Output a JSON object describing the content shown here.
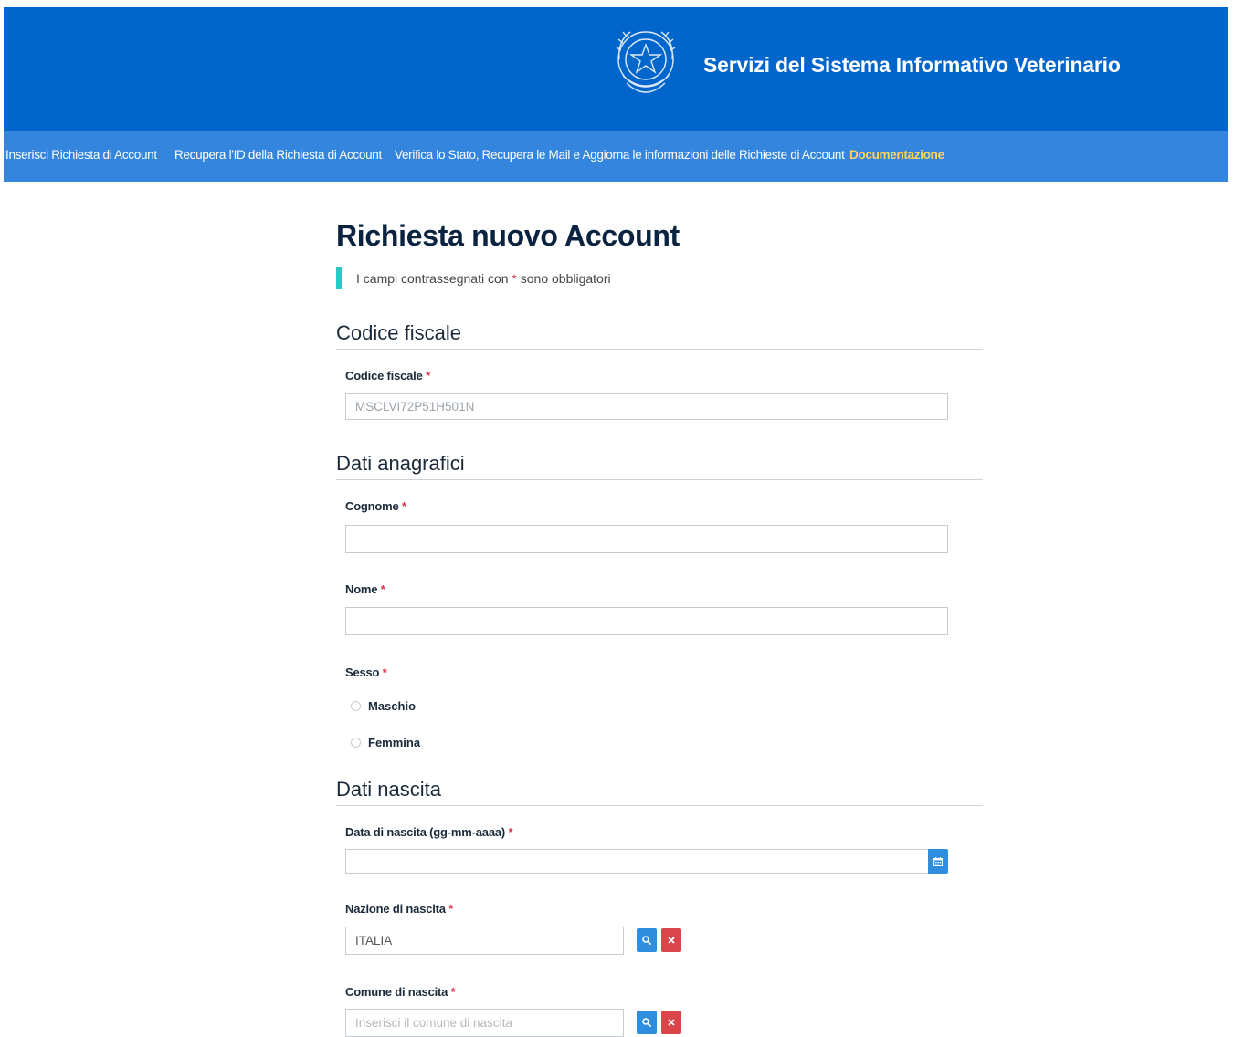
{
  "header": {
    "site_title": "Servizi del Sistema Informativo Veterinario",
    "emblem_icon": "italian-republic-emblem-icon",
    "background_color": "#0066cc"
  },
  "nav": {
    "background_color": "#3385dd",
    "items": [
      {
        "label": "Inserisci Richiesta di Account",
        "active": false
      },
      {
        "label": "Recupera l'ID della Richiesta di Account",
        "active": false
      },
      {
        "label": "Verifica lo Stato, Recupera le Mail e Aggiorna le informazioni delle Richieste di Account",
        "active": false
      },
      {
        "label": "Documentazione",
        "active": true
      }
    ],
    "active_color": "#ffd35a"
  },
  "form": {
    "title": "Richiesta nuovo Account",
    "required_note_prefix": "I campi contrassegnati con ",
    "required_star": "*",
    "required_note_suffix": " sono obbligatori",
    "sections": {
      "codice_fiscale": {
        "title": "Codice fiscale",
        "fields": {
          "codice_fiscale": {
            "label": "Codice fiscale",
            "value": "MSCLVI72P51H501N",
            "placeholder": ""
          }
        }
      },
      "dati_anagrafici": {
        "title": "Dati anagrafici",
        "fields": {
          "cognome": {
            "label": "Cognome",
            "value": "",
            "placeholder": ""
          },
          "nome": {
            "label": "Nome",
            "value": "",
            "placeholder": ""
          },
          "sesso": {
            "label": "Sesso",
            "options": [
              "Maschio",
              "Femmina"
            ]
          }
        }
      },
      "dati_nascita": {
        "title": "Dati nascita",
        "fields": {
          "data_nascita": {
            "label": "Data di nascita (gg-mm-aaaa)",
            "value": "",
            "placeholder": "",
            "icon": "calendar-icon"
          },
          "nazione_nascita": {
            "label": "Nazione di nascita",
            "value": "ITALIA",
            "placeholder": "",
            "search_icon": "search-icon",
            "clear_icon": "close-icon"
          },
          "comune_nascita": {
            "label": "Comune di nascita",
            "value": "",
            "placeholder": "Inserisci il comune di nascita",
            "search_icon": "search-icon",
            "clear_icon": "close-icon"
          }
        }
      }
    }
  },
  "colors": {
    "required_star": "#d9364f",
    "note_bar": "#2fc7c7",
    "button_blue": "#2f8fde",
    "button_red": "#d9454a"
  }
}
